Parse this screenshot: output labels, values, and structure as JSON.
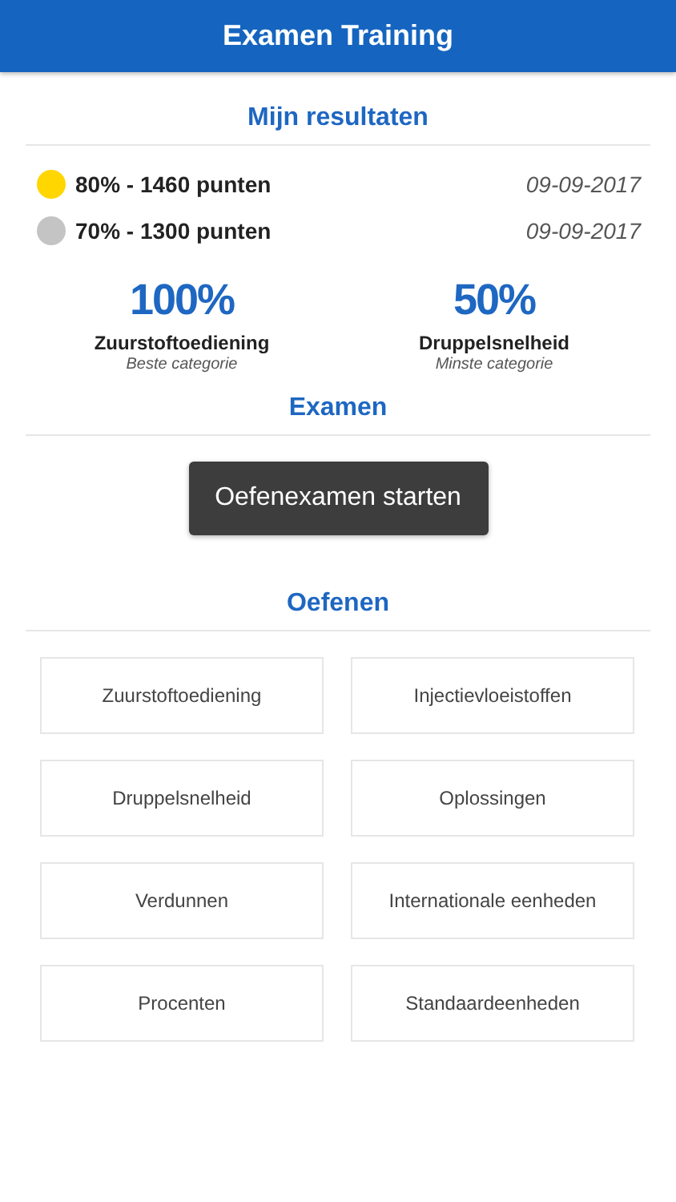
{
  "header": {
    "title": "Examen Training"
  },
  "results": {
    "title": "Mijn resultaten",
    "items": [
      {
        "label": "80% - 1460 punten",
        "date": "09-09-2017",
        "color": "#ffd600"
      },
      {
        "label": "70% - 1300 punten",
        "date": "09-09-2017",
        "color": "#c4c4c4"
      }
    ]
  },
  "stats": [
    {
      "value": "100%",
      "category": "Zuurstoftoediening",
      "caption": "Beste categorie"
    },
    {
      "value": "50%",
      "category": "Druppelsnelheid",
      "caption": "Minste categorie"
    }
  ],
  "exam": {
    "title": "Examen",
    "button": "Oefenexamen starten"
  },
  "practice": {
    "title": "Oefenen",
    "items": [
      "Zuurstoftoediening",
      "Injectievloeistoffen",
      "Druppelsnelheid",
      "Oplossingen",
      "Verdunnen",
      "Internationale eenheden",
      "Procenten",
      "Standaardeenheden"
    ]
  }
}
